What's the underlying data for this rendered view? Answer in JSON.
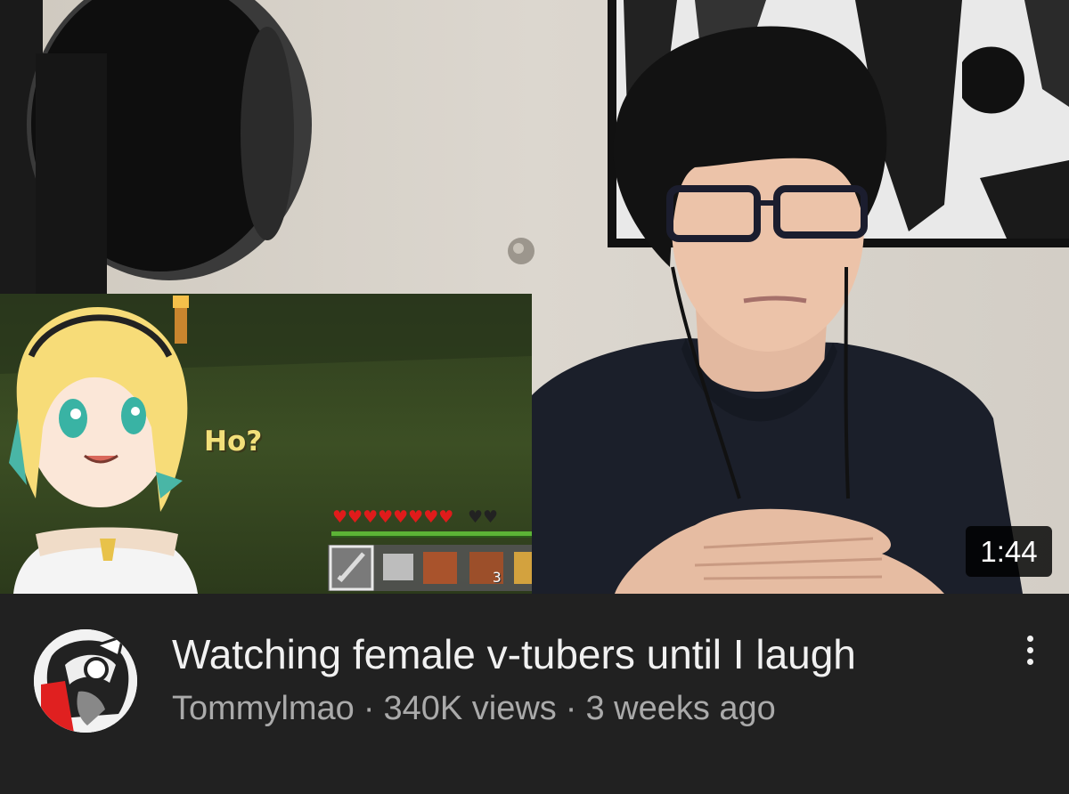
{
  "video": {
    "duration": "1:44",
    "title": "Watching female v-tubers until I laugh",
    "channel": "Tommylmao",
    "views": "340K views",
    "separator": "·",
    "age": "3 weeks ago"
  },
  "thumbnail": {
    "inset_speech": "Ho?",
    "hotbar_count": "3",
    "health_hearts_full": 8,
    "health_hearts_total": 10
  },
  "icons": {
    "menu": "more-vert-icon",
    "avatar": "channel-avatar"
  },
  "colors": {
    "background": "#212121",
    "title": "#f1f1f1",
    "subtitle": "#aaaaaa",
    "duration_badge": "#000000"
  }
}
